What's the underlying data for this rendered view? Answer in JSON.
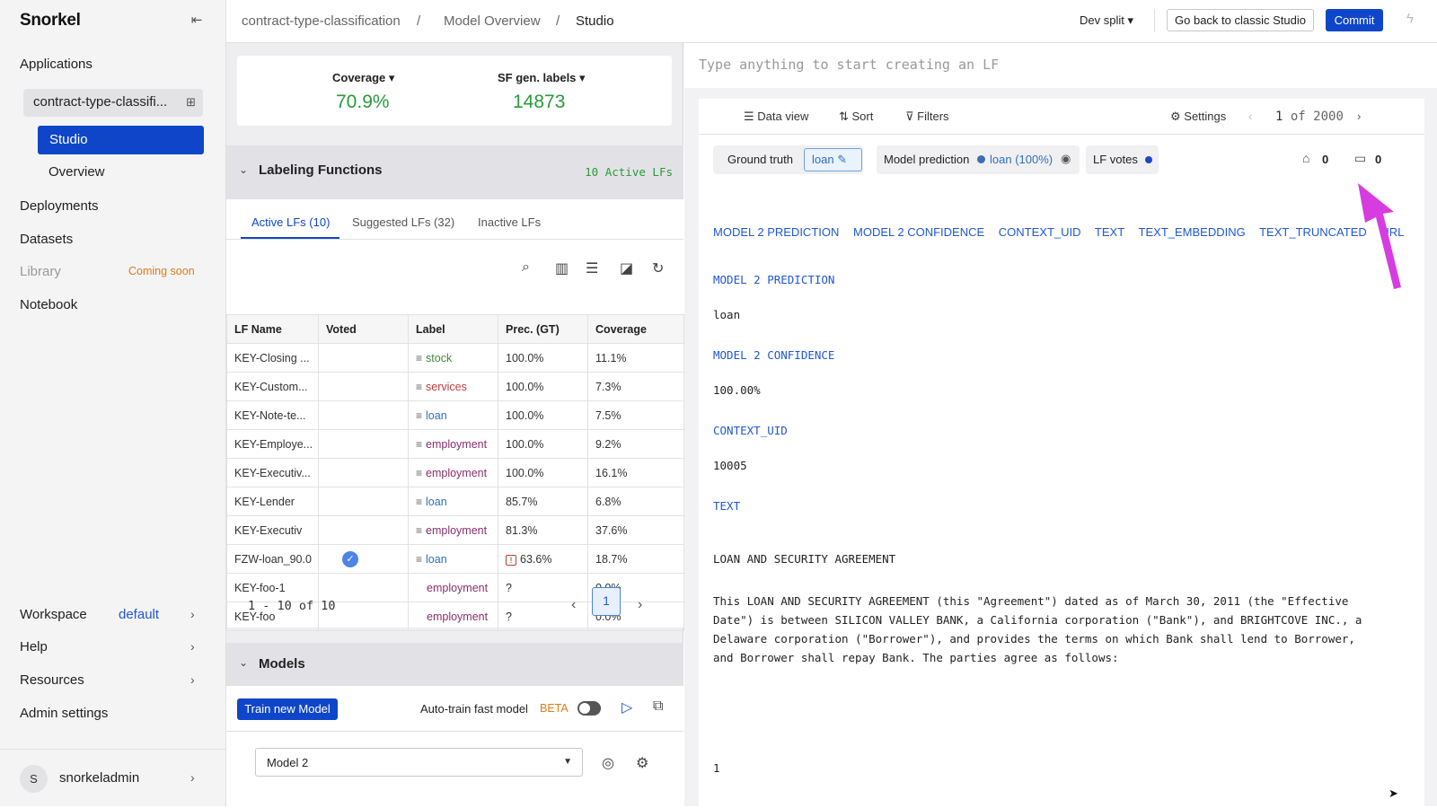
{
  "app": {
    "logo": "Snorkel"
  },
  "sidebar": {
    "applications": "Applications",
    "app_name": "contract-type-classifi...",
    "studio": "Studio",
    "overview": "Overview",
    "deployments": "Deployments",
    "datasets": "Datasets",
    "library": "Library",
    "coming_soon": "Coming soon",
    "notebook": "Notebook",
    "workspace": "Workspace",
    "workspace_value": "default",
    "help": "Help",
    "resources": "Resources",
    "admin_settings": "Admin settings",
    "avatar_initial": "S",
    "username": "snorkeladmin"
  },
  "topbar": {
    "crumb1": "contract-type-classification",
    "crumb2": "Model Overview",
    "crumb3": "Studio",
    "sep": "/",
    "dev_split": "Dev split ▾",
    "classic_btn": "Go back to classic Studio",
    "commit_btn": "Commit"
  },
  "metrics": {
    "coverage_label": "Coverage ▾",
    "coverage_value": "70.9%",
    "sf_label": "SF gen. labels ▾",
    "sf_value": "14873"
  },
  "lf_panel": {
    "title": "Labeling Functions",
    "active_count": "10 Active LFs",
    "tabs": [
      "Active LFs (10)",
      "Suggested LFs (32)",
      "Inactive LFs"
    ],
    "columns": [
      "LF Name",
      "Voted",
      "Label",
      "Prec. (GT)",
      "Coverage"
    ],
    "pager_text": "1 - 10 of 10",
    "pager_page": "1"
  },
  "lf_rows": [
    {
      "name": "KEY-Closing ...",
      "label": "stock",
      "prec": "100.0%",
      "coverage": "11.1%"
    },
    {
      "name": "KEY-Custom...",
      "label": "services",
      "prec": "100.0%",
      "coverage": "7.3%"
    },
    {
      "name": "KEY-Note-te...",
      "label": "loan",
      "prec": "100.0%",
      "coverage": "7.5%"
    },
    {
      "name": "KEY-Employe...",
      "label": "employment",
      "prec": "100.0%",
      "coverage": "9.2%"
    },
    {
      "name": "KEY-Executiv...",
      "label": "employment",
      "prec": "100.0%",
      "coverage": "16.1%"
    },
    {
      "name": "KEY-Lender",
      "label": "loan",
      "prec": "85.7%",
      "coverage": "6.8%"
    },
    {
      "name": "KEY-Executiv",
      "label": "employment",
      "prec": "81.3%",
      "coverage": "37.6%"
    },
    {
      "name": "FZW-loan_90.0",
      "label": "loan",
      "prec": "63.6%",
      "coverage": "18.7%"
    },
    {
      "name": "KEY-foo-1",
      "label": "employment",
      "prec": "?",
      "coverage": "0.0%"
    },
    {
      "name": "KEY-foo",
      "label": "employment",
      "prec": "?",
      "coverage": "0.0%"
    }
  ],
  "models": {
    "title": "Models",
    "train_btn": "Train new Model",
    "autotrain": "Auto-train fast model",
    "beta": "BETA",
    "selected_model": "Model 2"
  },
  "right": {
    "lf_input_placeholder": "Type anything to start creating an LF",
    "data_view": "Data view",
    "sort": "Sort",
    "filters": "Filters",
    "settings": "Settings",
    "page_current": "1",
    "page_of": "of 2000",
    "ground_truth_label": "Ground truth",
    "ground_truth_value": "loan",
    "model_prediction_label": "Model prediction",
    "model_prediction_value": "loan (100%)",
    "lf_votes_label": "LF votes",
    "tag_count": "0",
    "comment_count": "0",
    "field_links": [
      "MODEL 2 PREDICTION",
      "MODEL 2 CONFIDENCE",
      "CONTEXT_UID",
      "TEXT",
      "TEXT_EMBEDDING",
      "TEXT_TRUNCATED",
      "URL"
    ],
    "f1_key": "MODEL 2 PREDICTION",
    "f1_val": "loan",
    "f2_key": "MODEL 2 CONFIDENCE",
    "f2_val": "100.00%",
    "f3_key": "CONTEXT_UID",
    "f3_val": "10005",
    "f4_key": "TEXT",
    "doc_title": "LOAN AND SECURITY AGREEMENT",
    "doc_para": "This LOAN AND SECURITY AGREEMENT (this \"Agreement\") dated as of March 30, 2011 (the \"Effective Date\") is between SILICON VALLEY BANK, a California corporation (\"Bank\"), and BRIGHTCOVE INC., a Delaware corporation (\"Borrower\"), and provides the terms on which Bank shall lend to Borrower, and Borrower shall repay Bank. The parties agree as follows:",
    "doc_page": "1"
  },
  "colors": {
    "accent": "#0f46c9",
    "green": "#2a9a3a",
    "annotation": "#d63ce0"
  }
}
